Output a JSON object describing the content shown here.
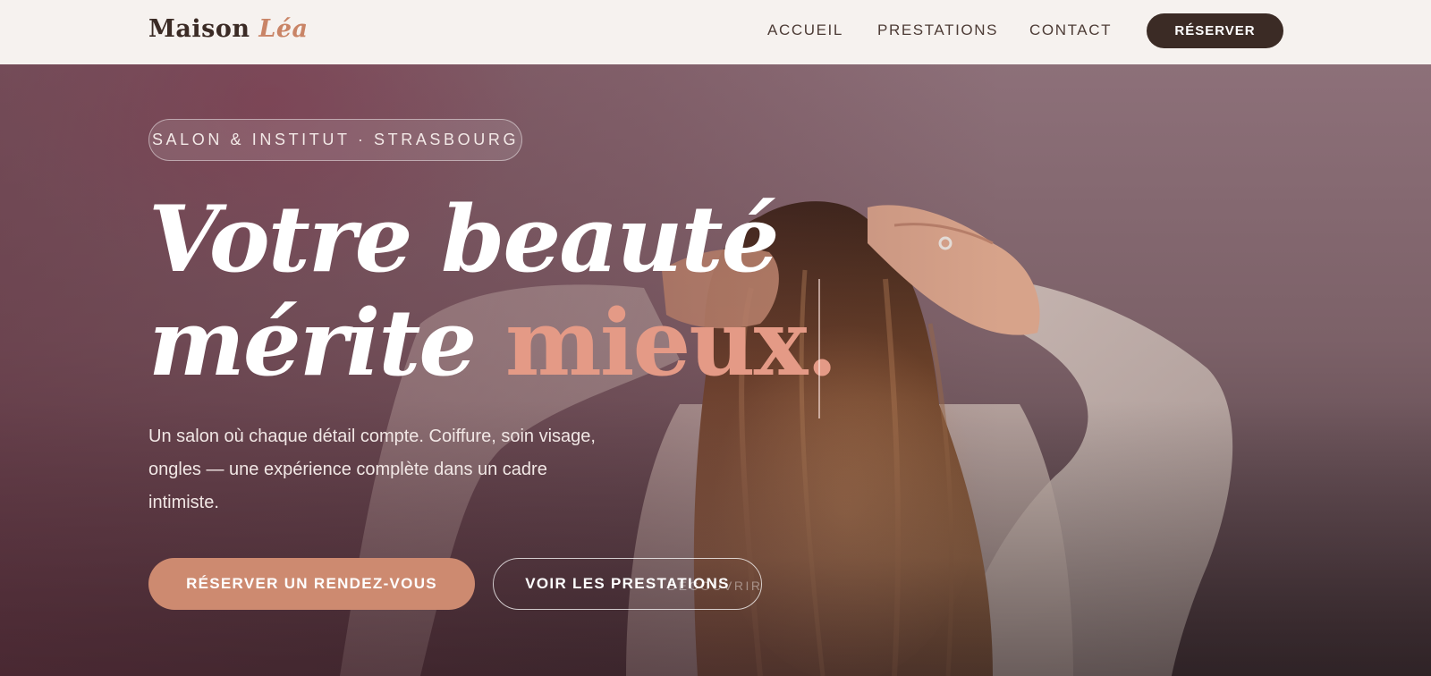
{
  "nav": {
    "brand_main": "Maison",
    "brand_accent": "Léa",
    "links": [
      "ACCUEIL",
      "PRESTATIONS",
      "CONTACT"
    ],
    "cta": "RÉSERVER"
  },
  "hero": {
    "badge": "SALON & INSTITUT · STRASBOURG",
    "headline_line1": "Votre beauté",
    "headline_line2_main": "mérite",
    "headline_line2_accent": "mieux.",
    "subtext": "Un salon où chaque détail compte. Coiffure, soin visage, ongles — une expérience complète dans un cadre intimiste.",
    "primary_button": "RÉSERVER UN RENDEZ-VOUS",
    "secondary_button": "VOIR LES PRESTATIONS",
    "scroll_hint": "DÉCOUVRIR"
  },
  "colors": {
    "brand_dark": "#3b2b25",
    "accent": "#c98466",
    "headline_accent": "#e49a86",
    "primary_button": "#cd8a70",
    "nav_background": "#f6f2ef"
  }
}
